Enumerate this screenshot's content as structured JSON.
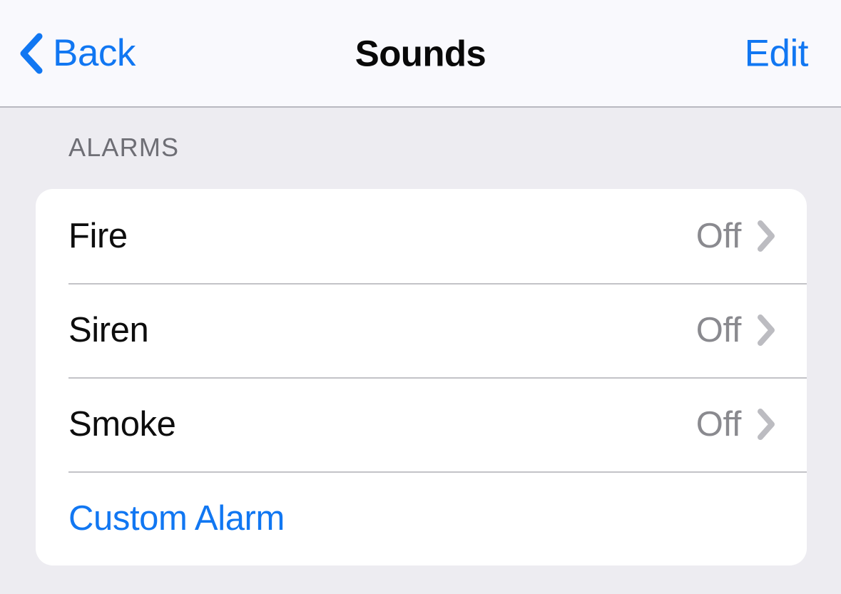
{
  "navbar": {
    "back_label": "Back",
    "back_icon": "chevron-left-icon",
    "title": "Sounds",
    "edit_label": "Edit",
    "accent_color": "#1177f2",
    "background_color": "#f9f9fd"
  },
  "page": {
    "background_color": "#edecf1"
  },
  "sections": [
    {
      "header": "ALARMS",
      "rows": [
        {
          "label": "Fire",
          "value": "Off",
          "accessory": "chevron-right-icon",
          "style": "default"
        },
        {
          "label": "Siren",
          "value": "Off",
          "accessory": "chevron-right-icon",
          "style": "default"
        },
        {
          "label": "Smoke",
          "value": "Off",
          "accessory": "chevron-right-icon",
          "style": "default"
        },
        {
          "label": "Custom Alarm",
          "value": "",
          "accessory": "",
          "style": "accent"
        }
      ]
    }
  ]
}
